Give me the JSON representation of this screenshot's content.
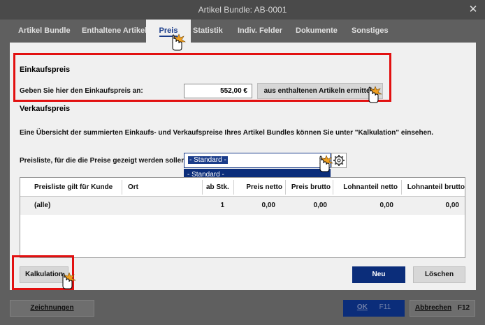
{
  "window": {
    "title": "Artikel Bundle: AB-0001",
    "close_glyph": "✕"
  },
  "tabs": [
    {
      "label": "Artikel Bundle"
    },
    {
      "label": "Enthaltene Artikel"
    },
    {
      "label": "Preis"
    },
    {
      "label": "Statistik"
    },
    {
      "label": "Indiv. Felder"
    },
    {
      "label": "Dokumente"
    },
    {
      "label": "Sonstiges"
    }
  ],
  "einkauf": {
    "heading": "Einkaufspreis",
    "label": "Geben Sie hier den Einkaufspreis an:",
    "value": "552,00 €",
    "button": "aus enthaltenen Artikeln ermitteln"
  },
  "verkauf": {
    "heading": "Verkaufspreis",
    "info": "Eine Übersicht der summierten Einkaufs- und Verkaufspreise Ihres Artikel Bundles können Sie unter \"Kalkulation\" einsehen.",
    "preisliste_label": "Preisliste, für die die Preise gezeigt werden sollen:",
    "preisliste_value": "- Standard -",
    "dropdown_option": "- Standard -"
  },
  "table": {
    "headers": [
      "Preisliste gilt für Kunde",
      "Ort",
      "ab Stk.",
      "Preis netto",
      "Preis brutto",
      "Lohnanteil netto",
      "Lohnanteil brutto"
    ],
    "rows": [
      [
        "(alle)",
        "",
        "1",
        "0,00",
        "0,00",
        "0,00",
        "0,00"
      ]
    ]
  },
  "actions": {
    "kalkulation": "Kalkulation",
    "neu": "Neu",
    "loeschen": "Löschen"
  },
  "footer": {
    "zeichnungen": "Zeichnungen",
    "ok": "OK",
    "ok_key": "F11",
    "abbrechen": "Abbrechen",
    "abbrechen_key": "F12"
  },
  "colors": {
    "accent": "#0b2d7a",
    "highlight": "#e21010",
    "tab_active_text": "#1a3c8a"
  },
  "icons": [
    "close-icon",
    "gear-icon",
    "dropdown-arrow-icon",
    "hand-cursor-icon"
  ]
}
